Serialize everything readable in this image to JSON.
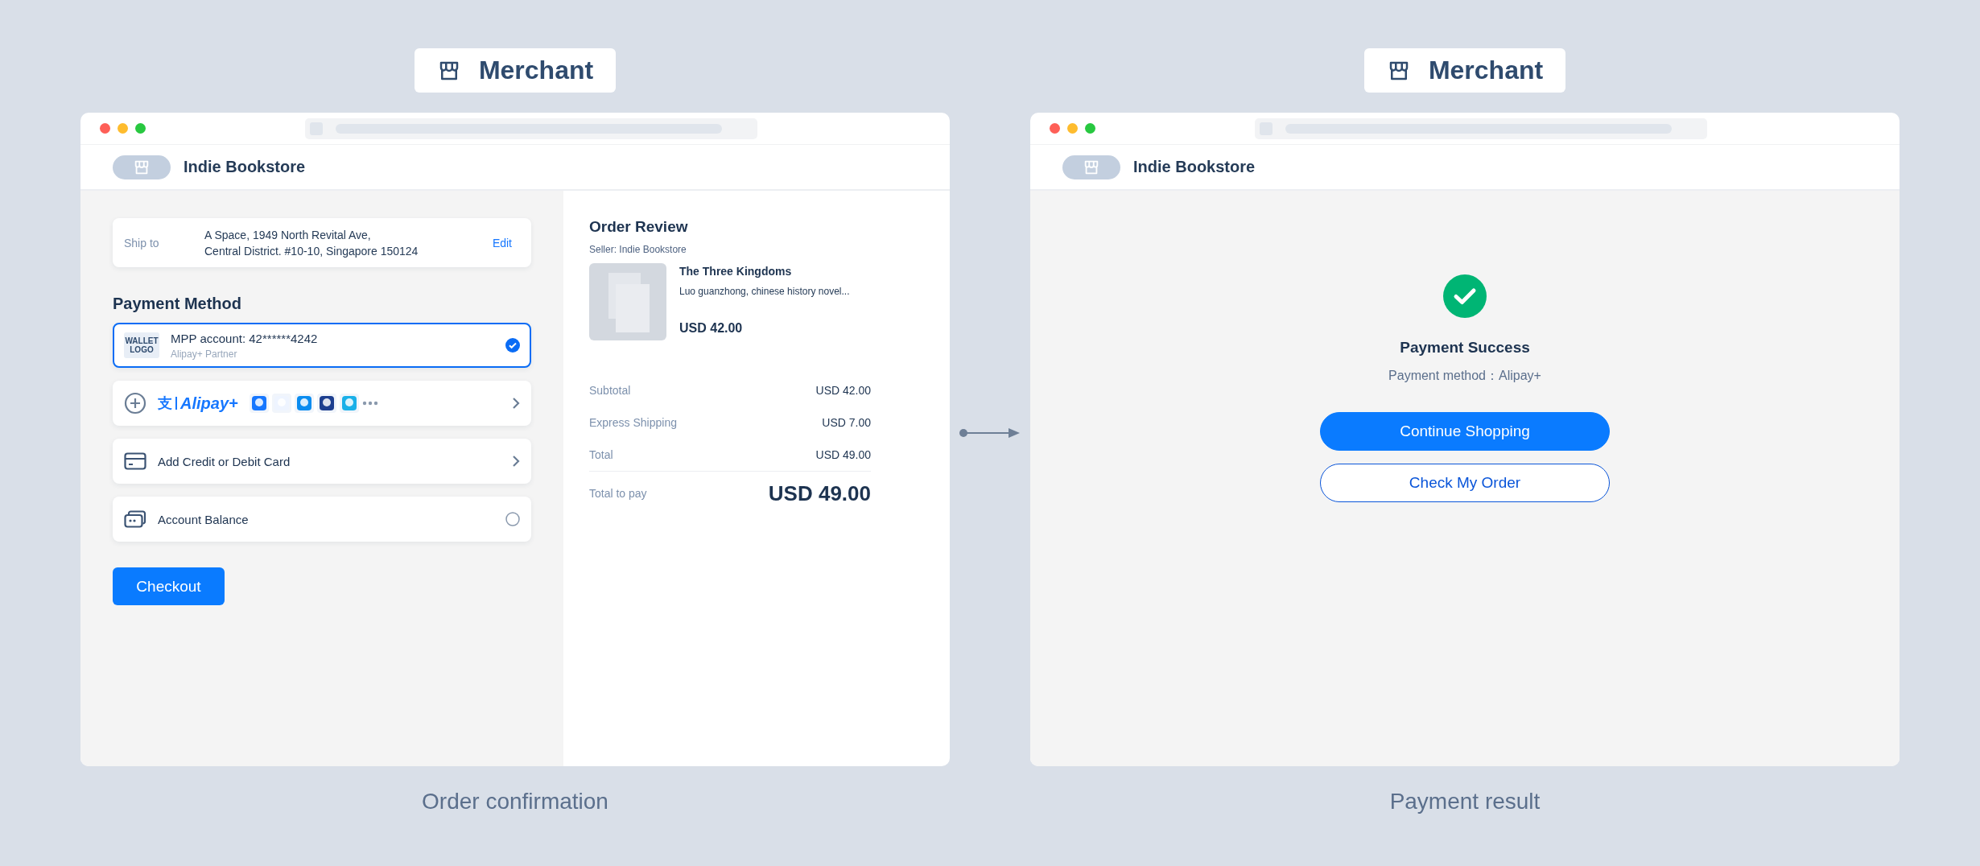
{
  "order_confirmation": {
    "badge": "Merchant",
    "store": "Indie Bookstore",
    "ship_to": {
      "label": "Ship to",
      "address": [
        "A Space, 1949 North Revital Ave,",
        "Central District. #10-10, Singapore 150124"
      ],
      "action": "Edit"
    },
    "payment_heading": "Payment Method",
    "payment_methods": [
      {
        "kind": "wallet",
        "logo": "WALLET LOGO",
        "title": "MPP account: 42******4242",
        "subtitle": "Alipay+ Partner",
        "selected": true
      },
      {
        "kind": "alipay",
        "mark": "支",
        "wordmark": "Alipay+",
        "selected": false
      },
      {
        "kind": "card",
        "title": "Add Credit or Debit Card",
        "selected": false
      },
      {
        "kind": "balance",
        "title": "Account Balance",
        "selected": false
      }
    ],
    "checkout": "Checkout",
    "review": {
      "title": "Order Review",
      "seller": "Seller: Indie Bookstore",
      "product": {
        "name": "The Three Kingdoms",
        "description": "Luo guanzhong, chinese history novel...",
        "price": "USD 42.00"
      },
      "lines": [
        {
          "label": "Subtotal",
          "amount": "USD 42.00"
        },
        {
          "label": "Express Shipping",
          "amount": "USD 7.00"
        },
        {
          "label": "Total",
          "amount": "USD 49.00"
        }
      ],
      "total_to_pay": {
        "label": "Total to pay",
        "amount": "USD 49.00"
      }
    },
    "caption": "Order confirmation"
  },
  "payment_result": {
    "badge": "Merchant",
    "store": "Indie Bookstore",
    "title": "Payment Success",
    "method": "Payment method：Alipay+",
    "buttons": [
      {
        "kind": "primary",
        "label": "Continue Shopping"
      },
      {
        "kind": "outline",
        "label": "Check My Order"
      }
    ],
    "caption": "Payment result"
  }
}
